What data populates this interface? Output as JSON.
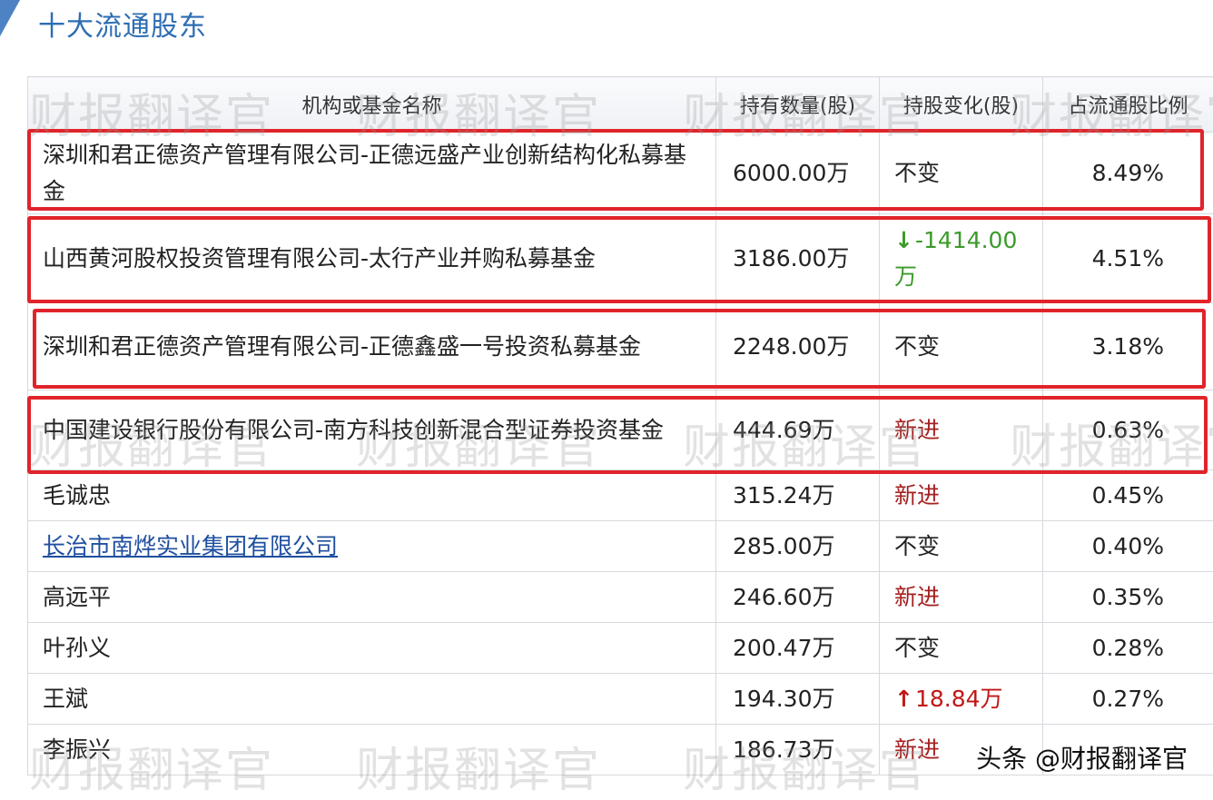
{
  "page": {
    "title": "十大流通股东",
    "footer_mark": "头条 @财报翻译官",
    "watermark": "财报翻译官"
  },
  "table": {
    "headers": [
      "机构或基金名称",
      "持有数量(股)",
      "持股变化(股)",
      "占流通股比例"
    ],
    "rows": [
      {
        "name": "深圳和君正德资产管理有限公司-正德远盛产业创新结构化私募基金",
        "qty": "6000.00万",
        "change": "不变",
        "change_type": "same",
        "pct": "8.49%"
      },
      {
        "name": "山西黄河股权投资管理有限公司-太行产业并购私募基金",
        "qty": "3186.00万",
        "change": "-1414.00万",
        "change_type": "down",
        "pct": "4.51%"
      },
      {
        "name": "深圳和君正德资产管理有限公司-正德鑫盛一号投资私募基金",
        "qty": "2248.00万",
        "change": "不变",
        "change_type": "same",
        "pct": "3.18%"
      },
      {
        "name": "中国建设银行股份有限公司-南方科技创新混合型证券投资基金",
        "qty": "444.69万",
        "change": "新进",
        "change_type": "new",
        "pct": "0.63%"
      },
      {
        "name": "毛诚忠",
        "qty": "315.24万",
        "change": "新进",
        "change_type": "new",
        "pct": "0.45%"
      },
      {
        "name": "长治市南烨实业集团有限公司",
        "qty": "285.00万",
        "change": "不变",
        "change_type": "same",
        "pct": "0.40%",
        "link": true
      },
      {
        "name": "高远平",
        "qty": "246.60万",
        "change": "新进",
        "change_type": "new",
        "pct": "0.35%"
      },
      {
        "name": "叶孙义",
        "qty": "200.47万",
        "change": "不变",
        "change_type": "same",
        "pct": "0.28%"
      },
      {
        "name": "王斌",
        "qty": "194.30万",
        "change": "18.84万",
        "change_type": "up",
        "pct": "0.27%"
      },
      {
        "name": "李振兴",
        "qty": "186.73万",
        "change": "新进",
        "change_type": "new",
        "pct": ""
      }
    ]
  },
  "colors": {
    "title": "#2d6db3",
    "new": "#a52020",
    "down": "#3c9a2b",
    "up": "#c01818",
    "highlight_box": "#e0242a"
  }
}
